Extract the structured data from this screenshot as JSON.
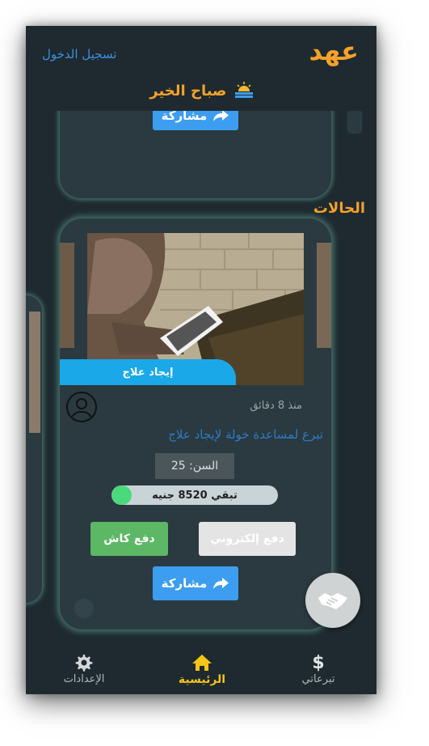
{
  "app": {
    "logo": "عهد",
    "login_link": "تسجيل الدخول",
    "greeting": "صباح الخير"
  },
  "previous_card": {
    "share_label": "مشاركة"
  },
  "section": {
    "title": "الحالات"
  },
  "case_card": {
    "tag": "إيجاد علاج",
    "time_ago": "منذ 8 دقائق",
    "title": "تبرع لمساعدة خولة لإيجاد علاج",
    "age_label": "السن: 25",
    "remaining_label": "تبقي 8520 جنيه",
    "progress_fraction": 0.12,
    "cash_button": "دفع كاش",
    "epay_button": "دفع إلكتروني",
    "share_button": "مشاركة"
  },
  "bottom_nav": {
    "items": [
      {
        "label": "الإعدادات",
        "icon": "gear-icon"
      },
      {
        "label": "الرئيسية",
        "icon": "home-icon",
        "active": true
      },
      {
        "label": "تبرعاتي",
        "icon": "dollar-icon"
      }
    ]
  },
  "colors": {
    "accent": "#f5a12b",
    "link": "#3d8fe0",
    "background": "#1e2a2f",
    "card": "#2a3a40",
    "share": "#3d9df0",
    "cash": "#5cb865",
    "tag": "#1aa8e8",
    "nav_active": "#f5c518"
  }
}
